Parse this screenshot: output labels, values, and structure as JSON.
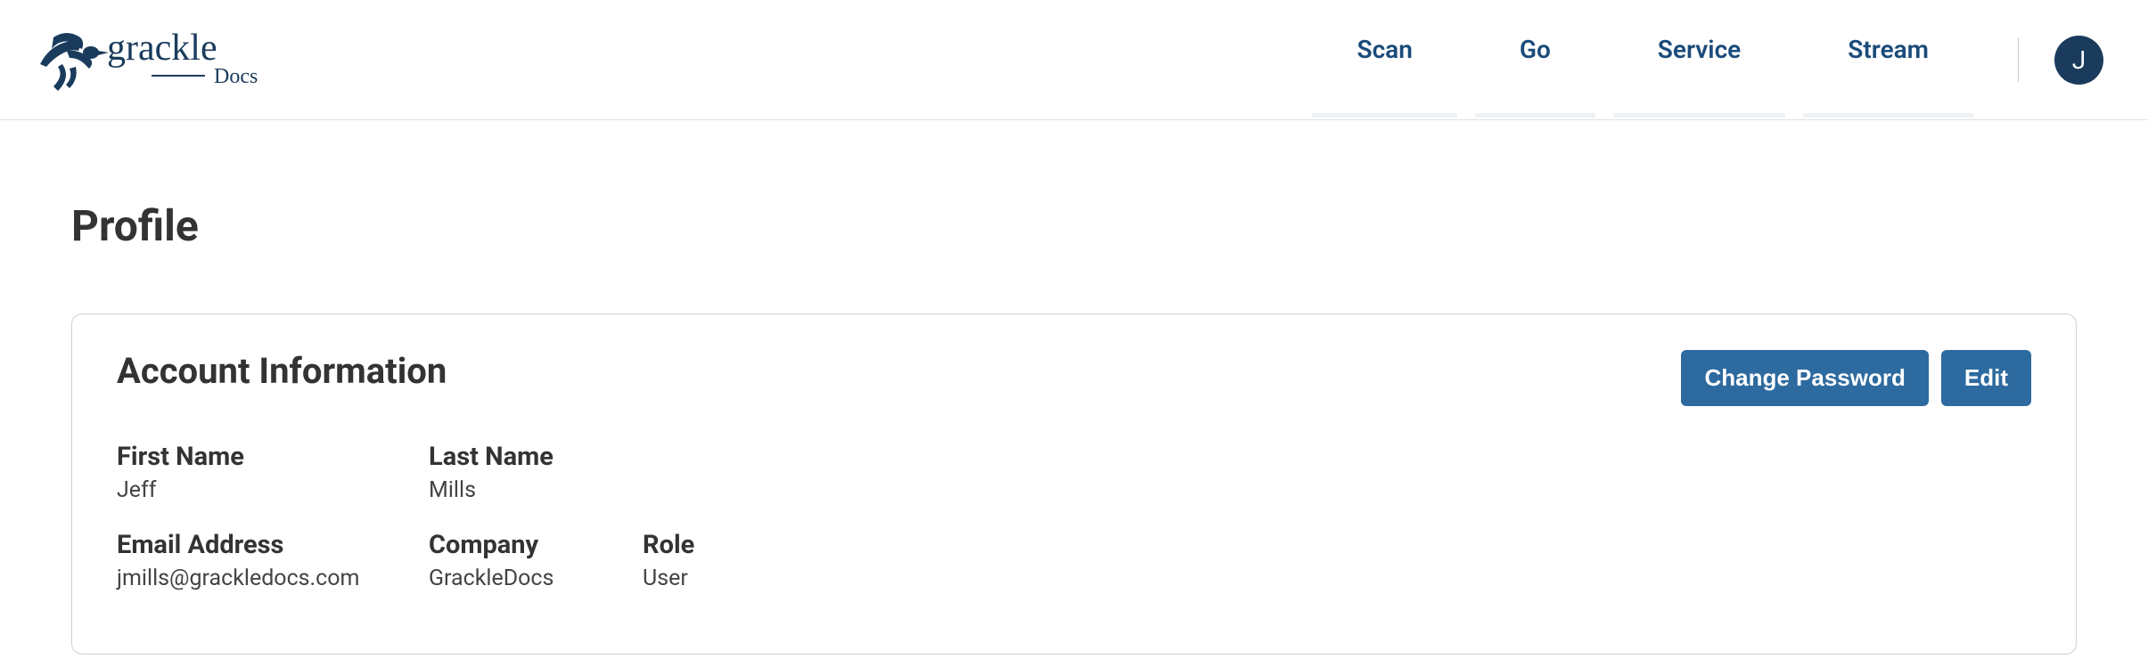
{
  "brand": {
    "name": "grackle",
    "sub": "Docs"
  },
  "nav": {
    "items": [
      {
        "label": "Scan"
      },
      {
        "label": "Go"
      },
      {
        "label": "Service"
      },
      {
        "label": "Stream"
      }
    ]
  },
  "avatar": {
    "initial": "J"
  },
  "page": {
    "title": "Profile"
  },
  "account": {
    "heading": "Account Information",
    "actions": {
      "change_password": "Change Password",
      "edit": "Edit"
    },
    "fields": {
      "first_name_label": "First Name",
      "first_name_value": "Jeff",
      "last_name_label": "Last Name",
      "last_name_value": "Mills",
      "email_label": "Email Address",
      "email_value": "jmills@grackledocs.com",
      "company_label": "Company",
      "company_value": "GrackleDocs",
      "role_label": "Role",
      "role_value": "User"
    }
  }
}
